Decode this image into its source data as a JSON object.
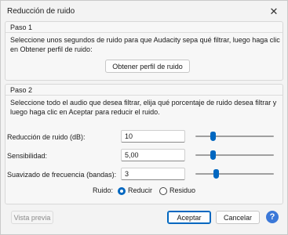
{
  "window": {
    "title": "Reducción de ruido"
  },
  "step1": {
    "title": "Paso 1",
    "description": "Seleccione unos segundos de ruido para que Audacity sepa qué filtrar, luego haga clic en Obtener perfil de ruido:",
    "button": "Obtener perfil de ruido"
  },
  "step2": {
    "title": "Paso 2",
    "description": "Seleccione todo el audio que desea filtrar, elija qué porcentaje de ruido desea filtrar y luego haga clic en Aceptar para reducir el ruido.",
    "rows": [
      {
        "label": "Reducción de ruido (dB):",
        "value": "10",
        "slider_fraction": 0.22
      },
      {
        "label": "Sensibilidad:",
        "value": "5,00",
        "slider_fraction": 0.22
      },
      {
        "label": "Suavizado de frecuencia (bandas):",
        "value": "3",
        "slider_fraction": 0.26
      }
    ],
    "noise": {
      "label": "Ruido:",
      "options": [
        "Reducir",
        "Residuo"
      ],
      "selected": "Reducir"
    }
  },
  "footer": {
    "preview": "Vista previa",
    "accept": "Aceptar",
    "cancel": "Cancelar",
    "help": "?"
  },
  "colors": {
    "accent": "#0067c0",
    "help": "#3b78d8"
  },
  "icons": {
    "close": "close-icon",
    "help": "help-icon"
  }
}
